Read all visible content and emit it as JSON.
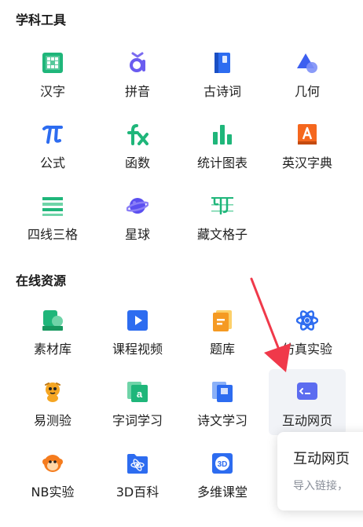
{
  "sections": [
    {
      "title": "学科工具"
    },
    {
      "title": "在线资源"
    }
  ],
  "tools": [
    {
      "label": "汉字",
      "icon": "hanzi-icon"
    },
    {
      "label": "拼音",
      "icon": "pinyin-icon"
    },
    {
      "label": "古诗词",
      "icon": "book-icon"
    },
    {
      "label": "几何",
      "icon": "geometry-icon"
    },
    {
      "label": "公式",
      "icon": "pi-icon"
    },
    {
      "label": "函数",
      "icon": "fx-icon"
    },
    {
      "label": "统计图表",
      "icon": "bar-chart-icon"
    },
    {
      "label": "英汉字典",
      "icon": "dictionary-icon"
    },
    {
      "label": "四线三格",
      "icon": "lines-icon"
    },
    {
      "label": "星球",
      "icon": "planet-icon"
    },
    {
      "label": "藏文格子",
      "icon": "tibetan-icon"
    }
  ],
  "resources": [
    {
      "label": "素材库",
      "icon": "material-icon"
    },
    {
      "label": "课程视频",
      "icon": "video-icon"
    },
    {
      "label": "题库",
      "icon": "question-bank-icon"
    },
    {
      "label": "仿真实验",
      "icon": "atom-icon"
    },
    {
      "label": "易测验",
      "icon": "mascot-icon"
    },
    {
      "label": "字词学习",
      "icon": "word-icon"
    },
    {
      "label": "诗文学习",
      "icon": "poem-icon"
    },
    {
      "label": "互动网页",
      "icon": "webpage-icon"
    },
    {
      "label": "NB实验",
      "icon": "monkey-icon"
    },
    {
      "label": "3D百科",
      "icon": "3d-icon"
    },
    {
      "label": "多维课堂",
      "icon": "classroom-icon"
    }
  ],
  "popup": {
    "title": "互动网页",
    "description": "导入链接，"
  },
  "colors": {
    "accent": "#3c6ff0",
    "green": "#1fb67a",
    "orange": "#f59a23",
    "red_arrow": "#f0394a"
  }
}
